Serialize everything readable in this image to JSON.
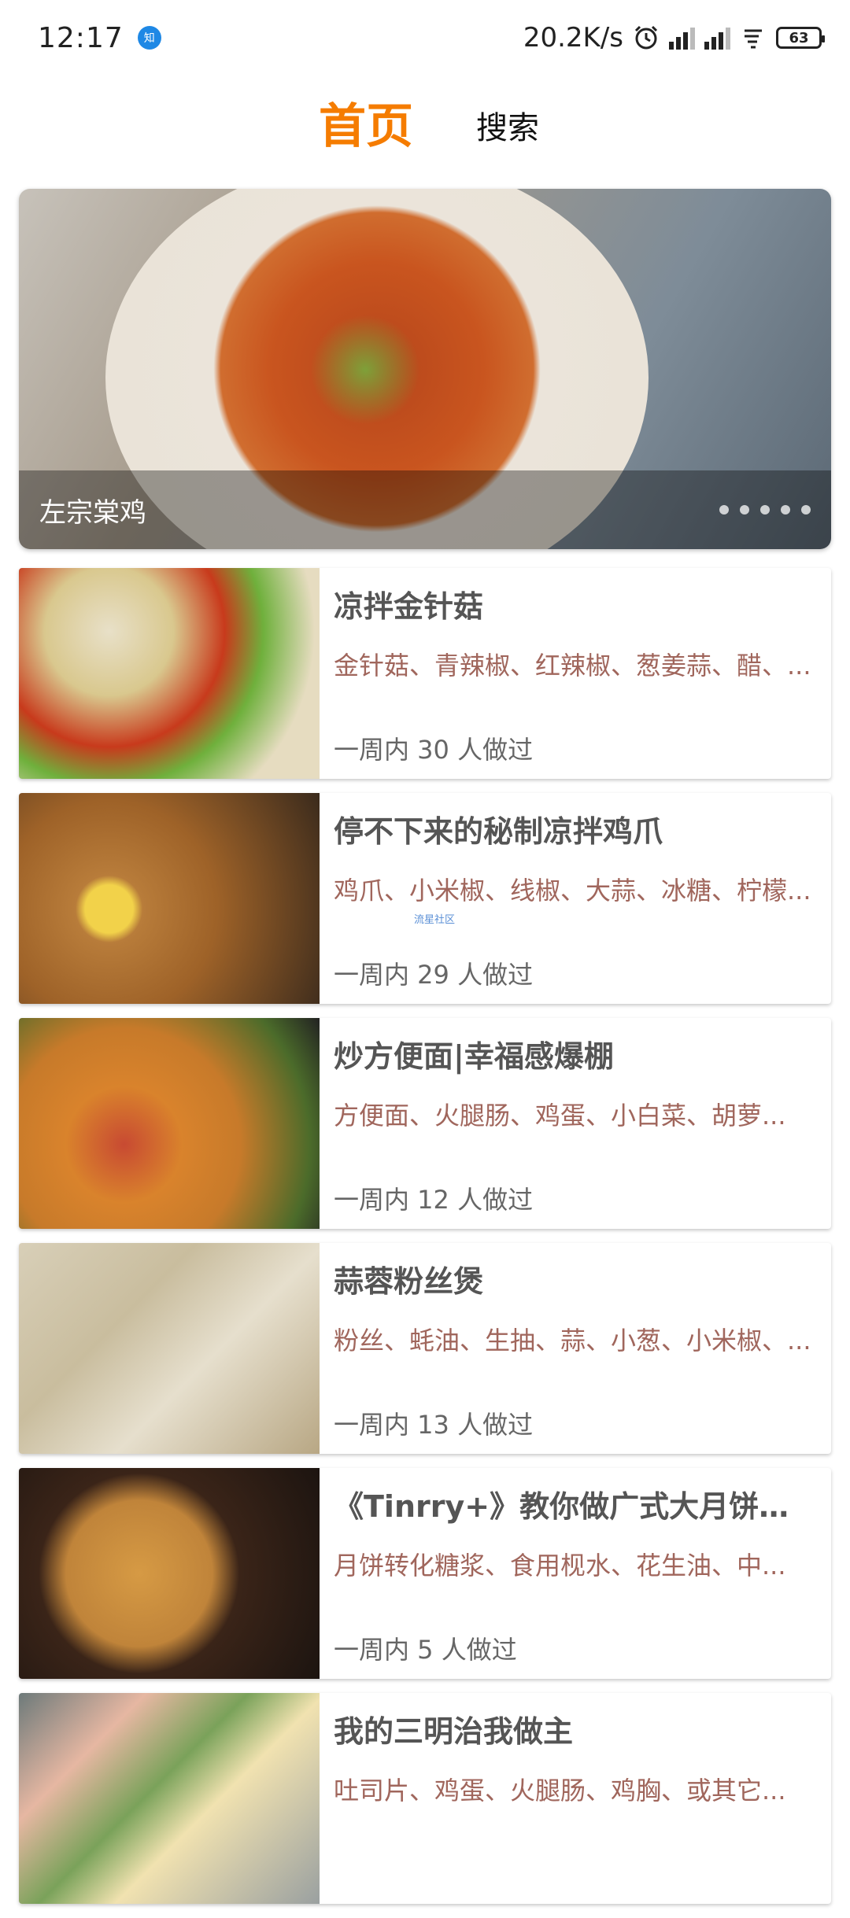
{
  "status_bar": {
    "time": "12:17",
    "notif_badge": "知",
    "net_speed": "20.2K/s",
    "battery": "63"
  },
  "tabs": {
    "home": "首页",
    "search": "搜索"
  },
  "banner": {
    "caption": "左宗棠鸡",
    "page_count": 5,
    "active_index": 0
  },
  "recipes": [
    {
      "title": "凉拌金针菇",
      "ingredients": "金针菇、青辣椒、红辣椒、葱姜蒜、醋、...",
      "made": "一周内 30 人做过"
    },
    {
      "title": "停不下来的秘制凉拌鸡爪",
      "ingredients": "鸡爪、小米椒、线椒、大蒜、冰糖、柠檬...",
      "made": "一周内 29 人做过",
      "watermark": "流星社区"
    },
    {
      "title": "炒方便面|幸福感爆棚",
      "ingredients": "方便面、火腿肠、鸡蛋、小白菜、胡萝...",
      "made": "一周内 12 人做过"
    },
    {
      "title": "蒜蓉粉丝煲",
      "ingredients": "粉丝、蚝油、生抽、蒜、小葱、小米椒、...",
      "made": "一周内 13 人做过"
    },
    {
      "title": "《Tinrry+》教你做广式大月饼（...",
      "ingredients": "月饼转化糖浆、食用枧水、花生油、中...",
      "made": "一周内 5 人做过"
    },
    {
      "title": "我的三明治我做主",
      "ingredients": "吐司片、鸡蛋、火腿肠、鸡胸、或其它...",
      "made": ""
    }
  ]
}
